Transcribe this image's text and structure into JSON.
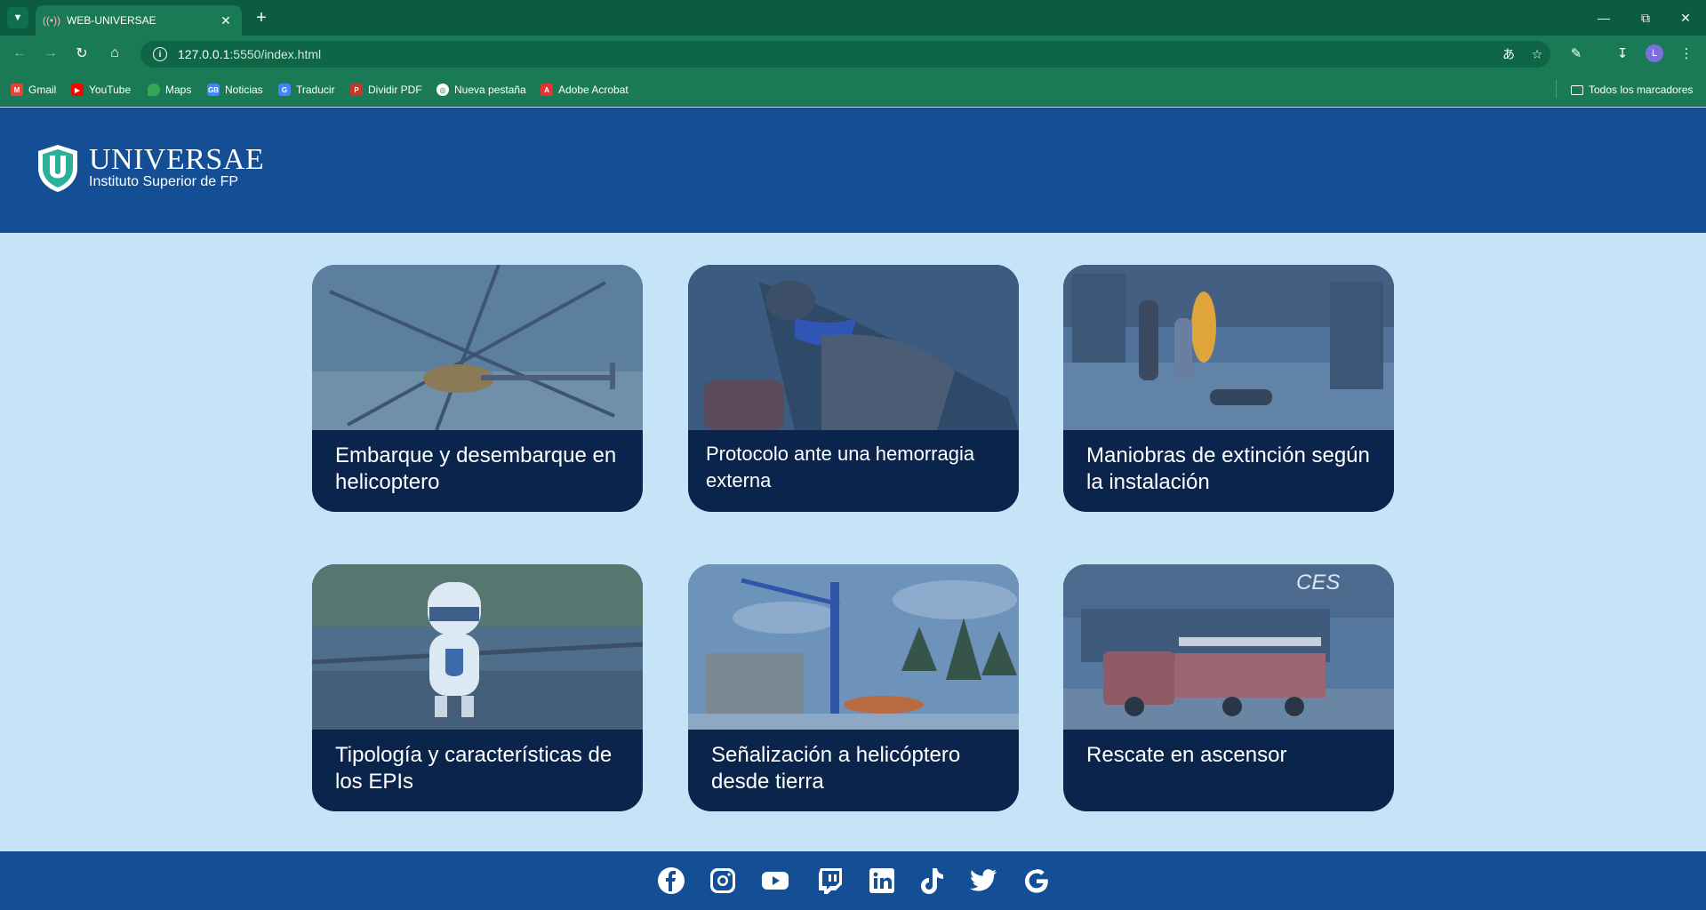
{
  "browser": {
    "tab_title": "WEB-UNIVERSAE",
    "url_host": "127.0.0.1",
    "url_path": ":5550/index.html",
    "profile_initial": "L",
    "bookmarks": [
      {
        "label": "Gmail",
        "icon": "gmail-icon",
        "color": "#ea4335"
      },
      {
        "label": "YouTube",
        "icon": "youtube-icon",
        "color": "#ff0000"
      },
      {
        "label": "Maps",
        "icon": "maps-icon",
        "color": "#34a853"
      },
      {
        "label": "Noticias",
        "icon": "news-icon",
        "color": "#4285f4"
      },
      {
        "label": "Traducir",
        "icon": "translate-icon",
        "color": "#4285f4"
      },
      {
        "label": "Dividir PDF",
        "icon": "pdf-icon",
        "color": "#c0392b"
      },
      {
        "label": "Nueva pestaña",
        "icon": "globe-icon",
        "color": "#ffffff"
      },
      {
        "label": "Adobe Acrobat",
        "icon": "acrobat-icon",
        "color": "#e3342f"
      }
    ],
    "all_bookmarks_label": "Todos los marcadores"
  },
  "header": {
    "logo_name": "UNIVERSAE",
    "logo_subtitle": "Instituto Superior de FP"
  },
  "courses": [
    {
      "title": "Embarque y desembarque en helicoptero",
      "image": "helicopter-top-view"
    },
    {
      "title": "Protocolo ante una hemorragia externa",
      "image": "injured-person"
    },
    {
      "title": "Maniobras de extinción según la instalación",
      "image": "office-fire"
    },
    {
      "title": "Tipología y características de los EPIs",
      "image": "robot-mascot"
    },
    {
      "title": "Señalización a helicóptero desde tierra",
      "image": "crane-helicopter"
    },
    {
      "title": "Rescate en ascensor",
      "image": "fire-truck"
    }
  ],
  "footer": {
    "social": [
      "facebook",
      "instagram",
      "youtube",
      "twitch",
      "linkedin",
      "tiktok",
      "twitter",
      "google"
    ]
  },
  "colors": {
    "chrome": "#1a7a55",
    "header": "#144f96",
    "background": "#c5e4f7",
    "card": "#0b244b"
  }
}
